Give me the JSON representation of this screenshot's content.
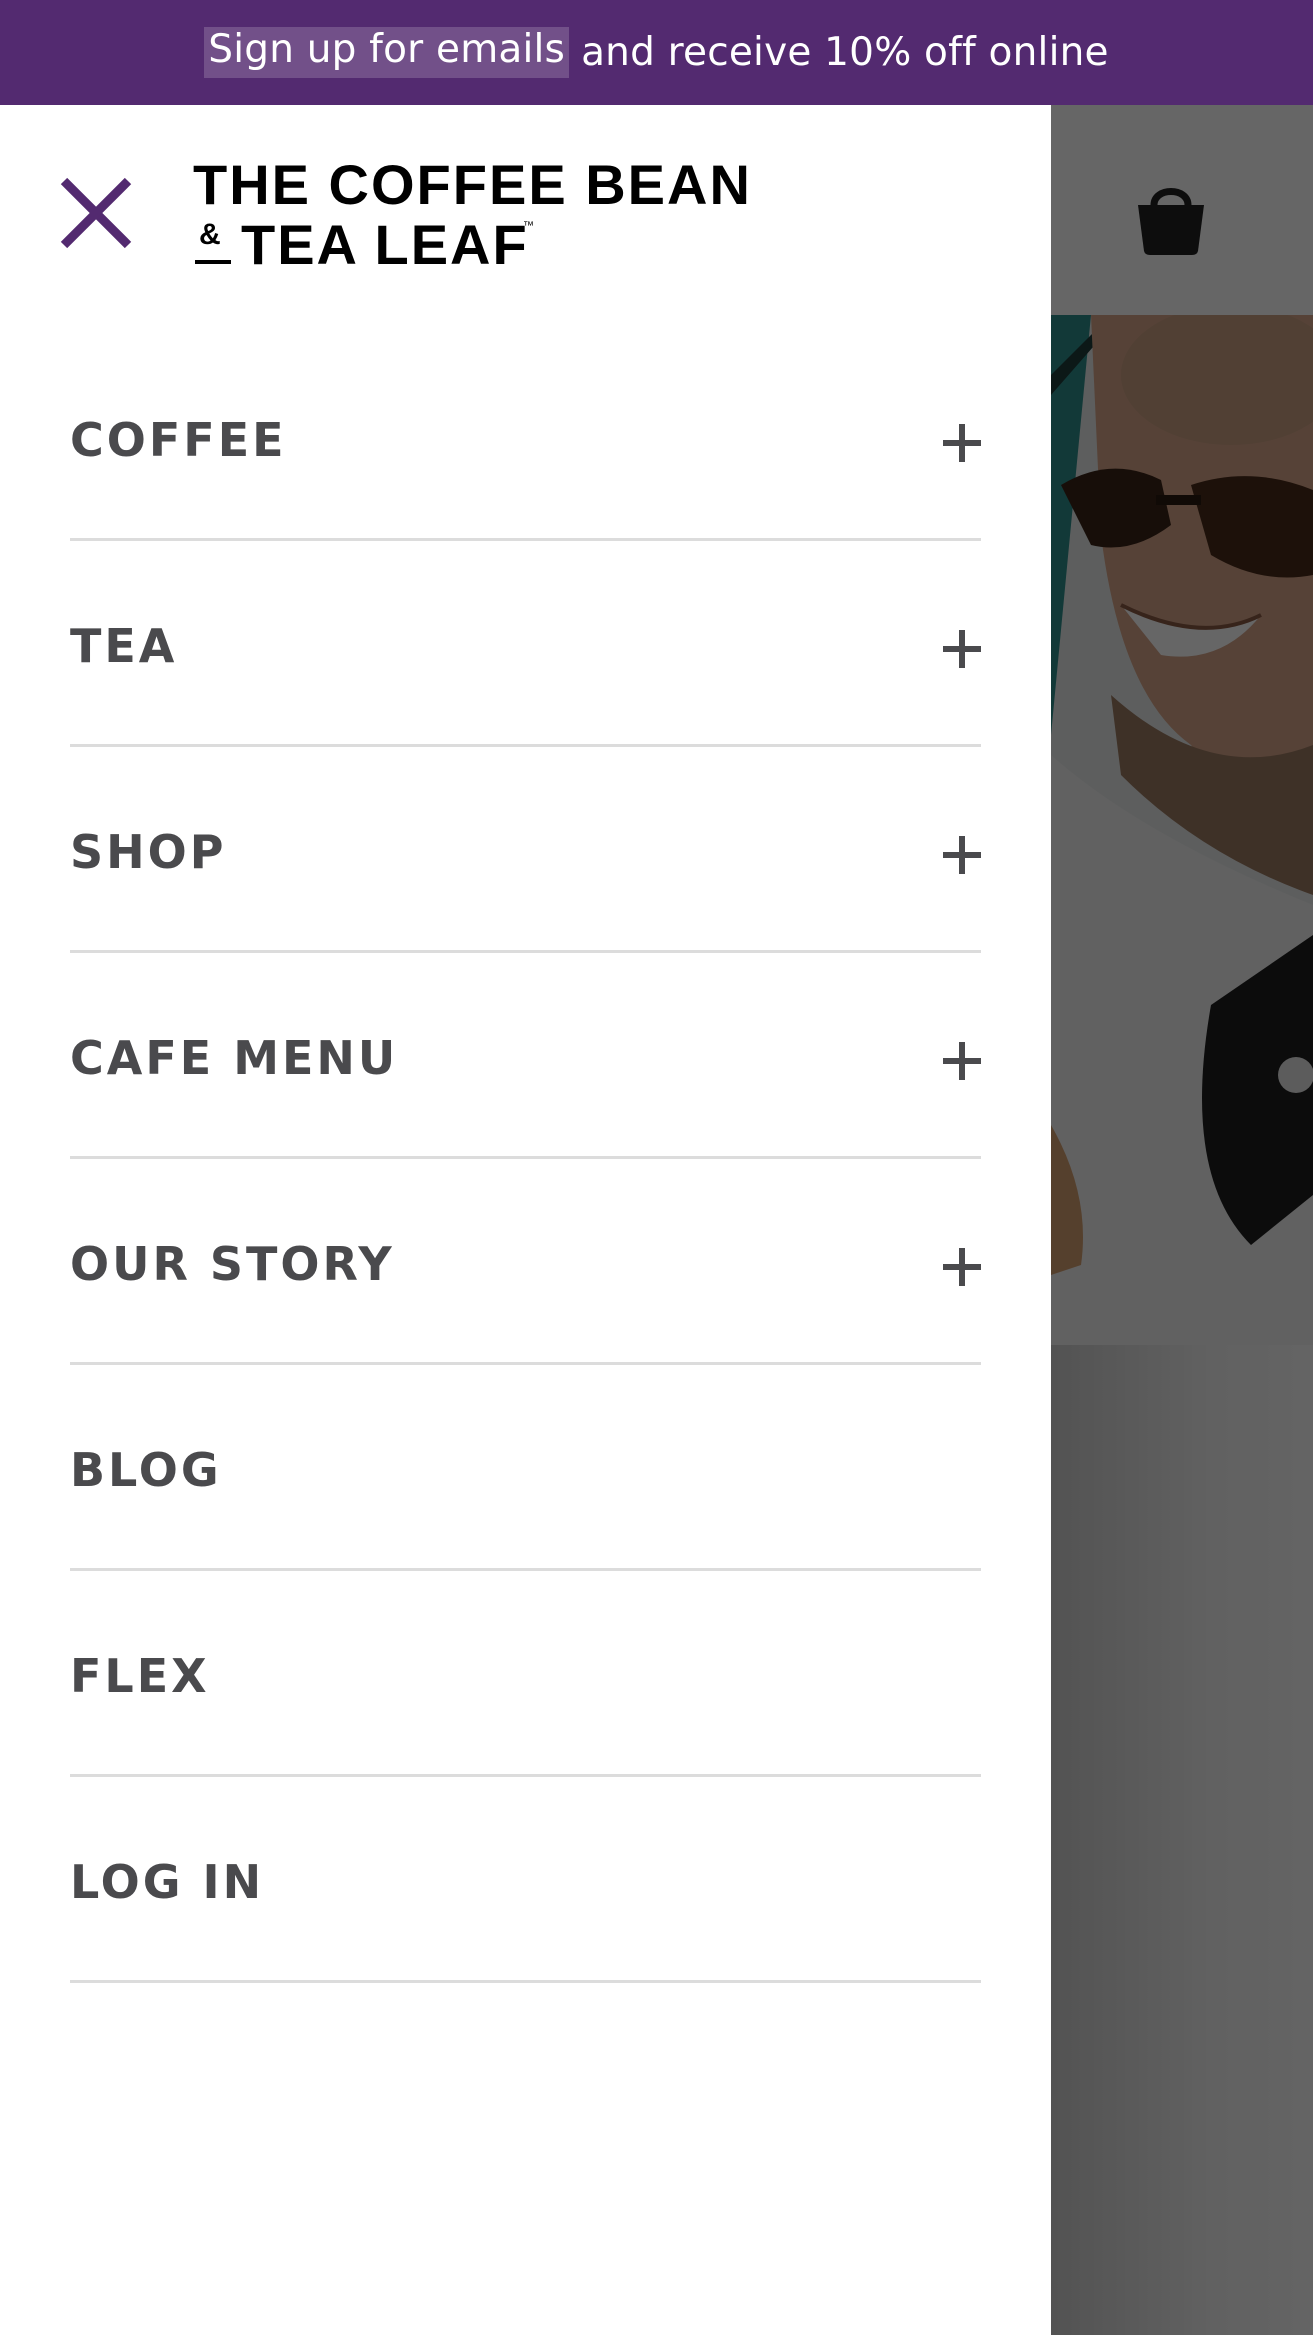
{
  "promo": {
    "link_text": "Sign up for emails",
    "rest_text": "and receive 10% off online",
    "background": "#532a70"
  },
  "header": {
    "logo_line1": "THE COFFEE BEAN",
    "logo_ampersand": "&",
    "logo_line2": "TEA LEAF",
    "logo_tm": "™",
    "close_icon": "close-icon",
    "cart_icon": "shopping-bag-icon",
    "accent": "#532a70"
  },
  "menu": {
    "items": [
      {
        "label": "COFFEE",
        "expandable": true
      },
      {
        "label": "TEA",
        "expandable": true
      },
      {
        "label": "SHOP",
        "expandable": true
      },
      {
        "label": "CAFE MENU",
        "expandable": true
      },
      {
        "label": "OUR STORY",
        "expandable": true
      },
      {
        "label": "BLOG",
        "expandable": false
      },
      {
        "label": "FLEX",
        "expandable": false
      },
      {
        "label": "LOG IN",
        "expandable": false
      }
    ],
    "text_color": "#4a4a4d",
    "divider_color": "#dcdcdc",
    "expand_icon": "plus-icon"
  }
}
